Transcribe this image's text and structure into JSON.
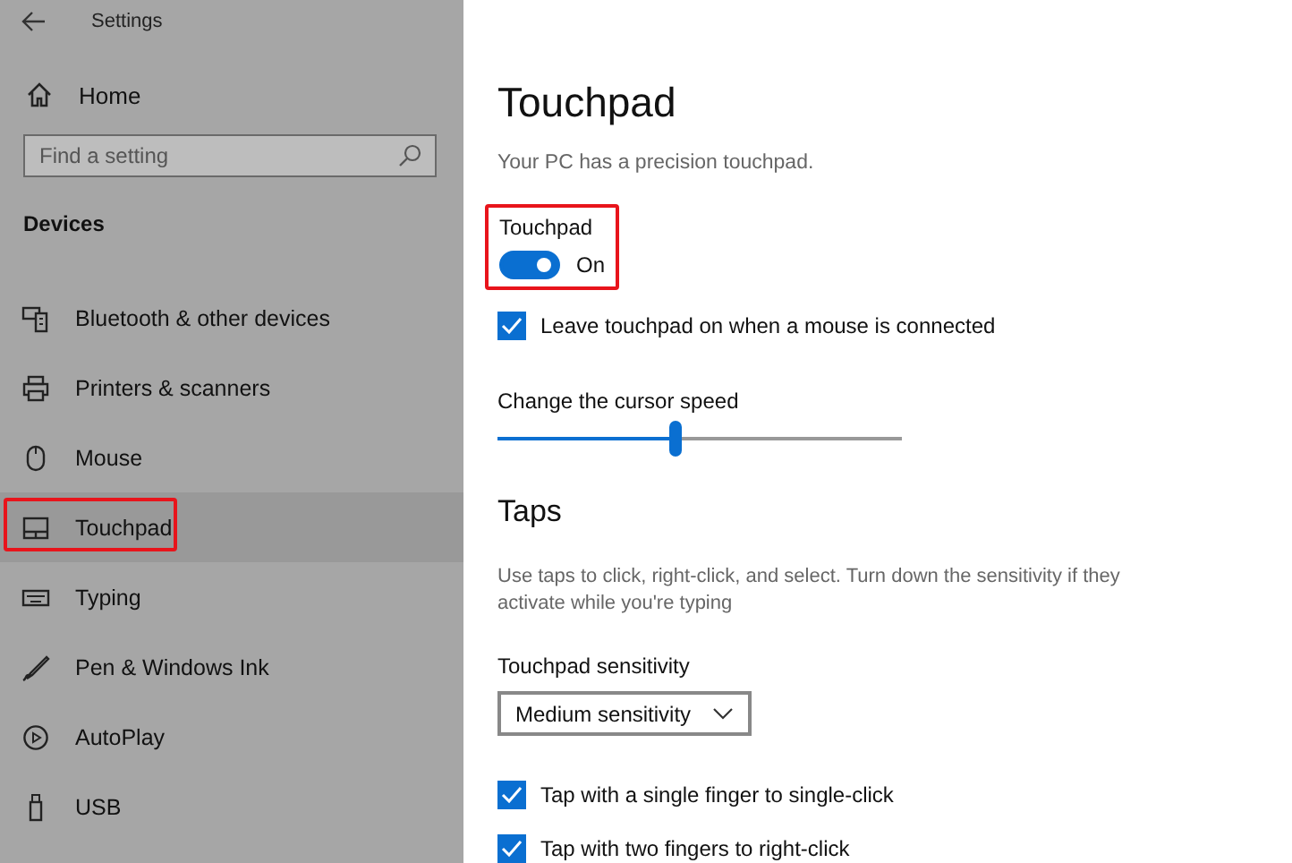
{
  "window": {
    "title": "Settings"
  },
  "sidebar": {
    "home": "Home",
    "search": {
      "placeholder": "Find a setting"
    },
    "section": "Devices",
    "items": [
      {
        "label": "Bluetooth & other devices",
        "kind": "bluetooth",
        "selected": false,
        "highlighted": false
      },
      {
        "label": "Printers & scanners",
        "kind": "printer",
        "selected": false,
        "highlighted": false
      },
      {
        "label": "Mouse",
        "kind": "mouse",
        "selected": false,
        "highlighted": false
      },
      {
        "label": "Touchpad",
        "kind": "touchpad",
        "selected": true,
        "highlighted": true
      },
      {
        "label": "Typing",
        "kind": "keyboard",
        "selected": false,
        "highlighted": false
      },
      {
        "label": "Pen & Windows Ink",
        "kind": "pen",
        "selected": false,
        "highlighted": false
      },
      {
        "label": "AutoPlay",
        "kind": "autoplay",
        "selected": false,
        "highlighted": false
      },
      {
        "label": "USB",
        "kind": "usb",
        "selected": false,
        "highlighted": false
      }
    ]
  },
  "main": {
    "title": "Touchpad",
    "subtitle": "Your PC has a precision touchpad.",
    "toggle": {
      "label": "Touchpad",
      "on": true,
      "state_text": "On",
      "highlighted": true
    },
    "leave_on": {
      "label": "Leave touchpad on when a mouse is connected",
      "checked": true
    },
    "speed": {
      "label": "Change the cursor speed",
      "level": 0.44
    },
    "taps": {
      "heading": "Taps",
      "description": "Use taps to click, right-click, and select. Turn down the sensitivity if they activate while you're typing",
      "sensitivity_label": "Touchpad sensitivity",
      "sensitivity_value": "Medium sensitivity",
      "options": [
        {
          "label": "Tap with a single finger to single-click",
          "checked": true
        },
        {
          "label": "Tap with two fingers to right-click",
          "checked": true
        }
      ]
    }
  }
}
